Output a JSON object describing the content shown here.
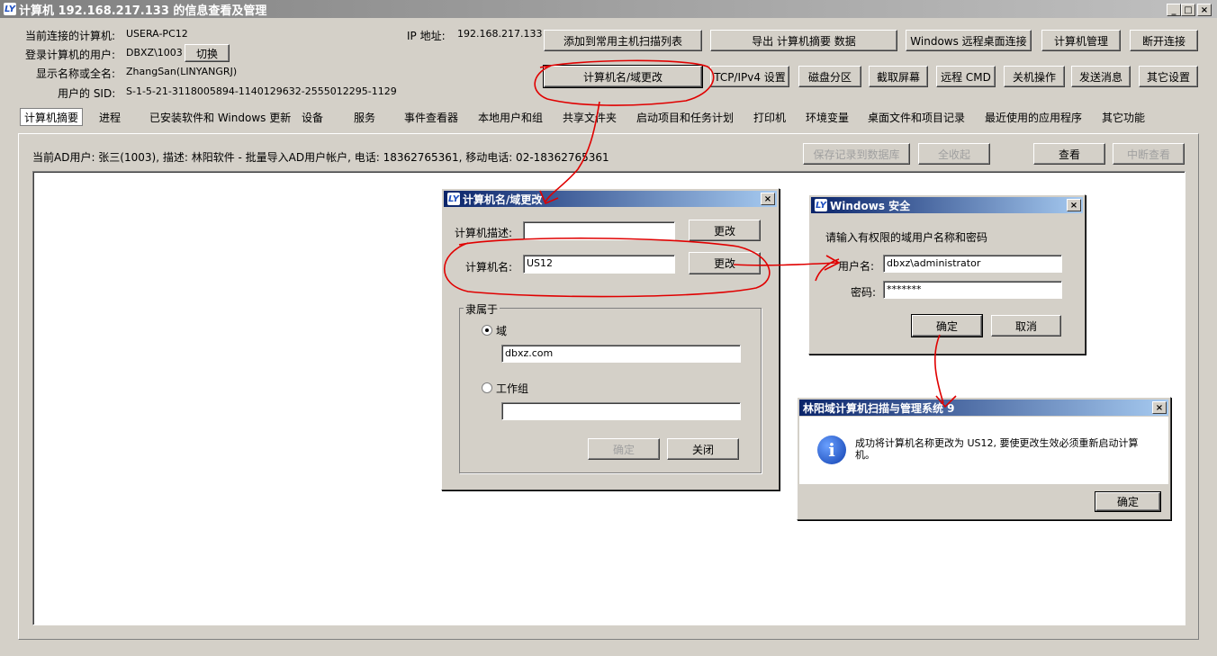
{
  "window": {
    "title": "计算机 192.168.217.133 的信息查看及管理",
    "controls": {
      "min": "_",
      "max": "□",
      "close": "×"
    }
  },
  "info": {
    "connected_label": "当前连接的计算机:",
    "connected_value": "USERA-PC12",
    "logged_user_label": "登录计算机的用户:",
    "logged_user_value": "DBXZ\\1003",
    "switch_button": "切换",
    "display_name_label": "显示名称或全名:",
    "display_name_value": "ZhangSan(LINYANGRJ)",
    "sid_label": "用户的 SID:",
    "sid_value": "S-1-5-21-3118005894-1140129632-2555012295-1129",
    "ip_label": "IP 地址:",
    "ip_value": "192.168.217.133"
  },
  "toolbar_row1": [
    "添加到常用主机扫描列表",
    "导出 计算机摘要 数据",
    "Windows 远程桌面连接",
    "计算机管理",
    "断开连接"
  ],
  "toolbar_row2": [
    "计算机名/域更改",
    "TCP/IPv4 设置",
    "磁盘分区",
    "截取屏幕",
    "远程 CMD",
    "关机操作",
    "发送消息",
    "其它设置"
  ],
  "tabs": [
    "计算机摘要",
    "进程",
    "已安装软件和 Windows 更新",
    "设备",
    "服务",
    "事件查看器",
    "本地用户和组",
    "共享文件夹",
    "启动项目和任务计划",
    "打印机",
    "环境变量",
    "桌面文件和项目记录",
    "最近使用的应用程序",
    "其它功能"
  ],
  "summary": {
    "ad_user_text": "当前AD用户: 张三(1003), 描述: 林阳软件 - 批量导入AD用户帐户, 电话: 18362765361, 移动电话: 02-18362765361",
    "save_button": "保存记录到数据库",
    "collapse_button": "全收起",
    "view_button": "查看",
    "stop_button": "中断查看"
  },
  "rename_dialog": {
    "title": "计算机名/域更改",
    "close": "×",
    "desc_label": "计算机描述:",
    "desc_value": "",
    "desc_change_button": "更改",
    "name_label": "计算机名:",
    "name_value": "US12",
    "name_change_button": "更改",
    "member_of_label": "隶属于",
    "domain_label": "域",
    "domain_value": "dbxz.com",
    "workgroup_label": "工作组",
    "workgroup_value": "",
    "ok_button": "确定",
    "close_button": "关闭"
  },
  "security_dialog": {
    "title": "Windows 安全",
    "close": "×",
    "prompt": "请输入有权限的域用户名称和密码",
    "user_label": "用户名:",
    "user_value": "dbxz\\administrator",
    "password_label": "密码:",
    "password_value": "*******",
    "ok_button": "确定",
    "cancel_button": "取消"
  },
  "message_dialog": {
    "title": "林阳域计算机扫描与管理系统 9",
    "close": "×",
    "icon": "info-icon",
    "message": "成功将计算机名称更改为 US12, 要使更改生效必须重新启动计算机。",
    "ok_button": "确定"
  },
  "colors": {
    "face": "#d4d0c8",
    "title_active_start": "#0a246a",
    "title_active_end": "#a6caf0",
    "title_inactive_start": "#808080",
    "title_inactive_end": "#c0c0c0",
    "annotation": "#e00000"
  }
}
